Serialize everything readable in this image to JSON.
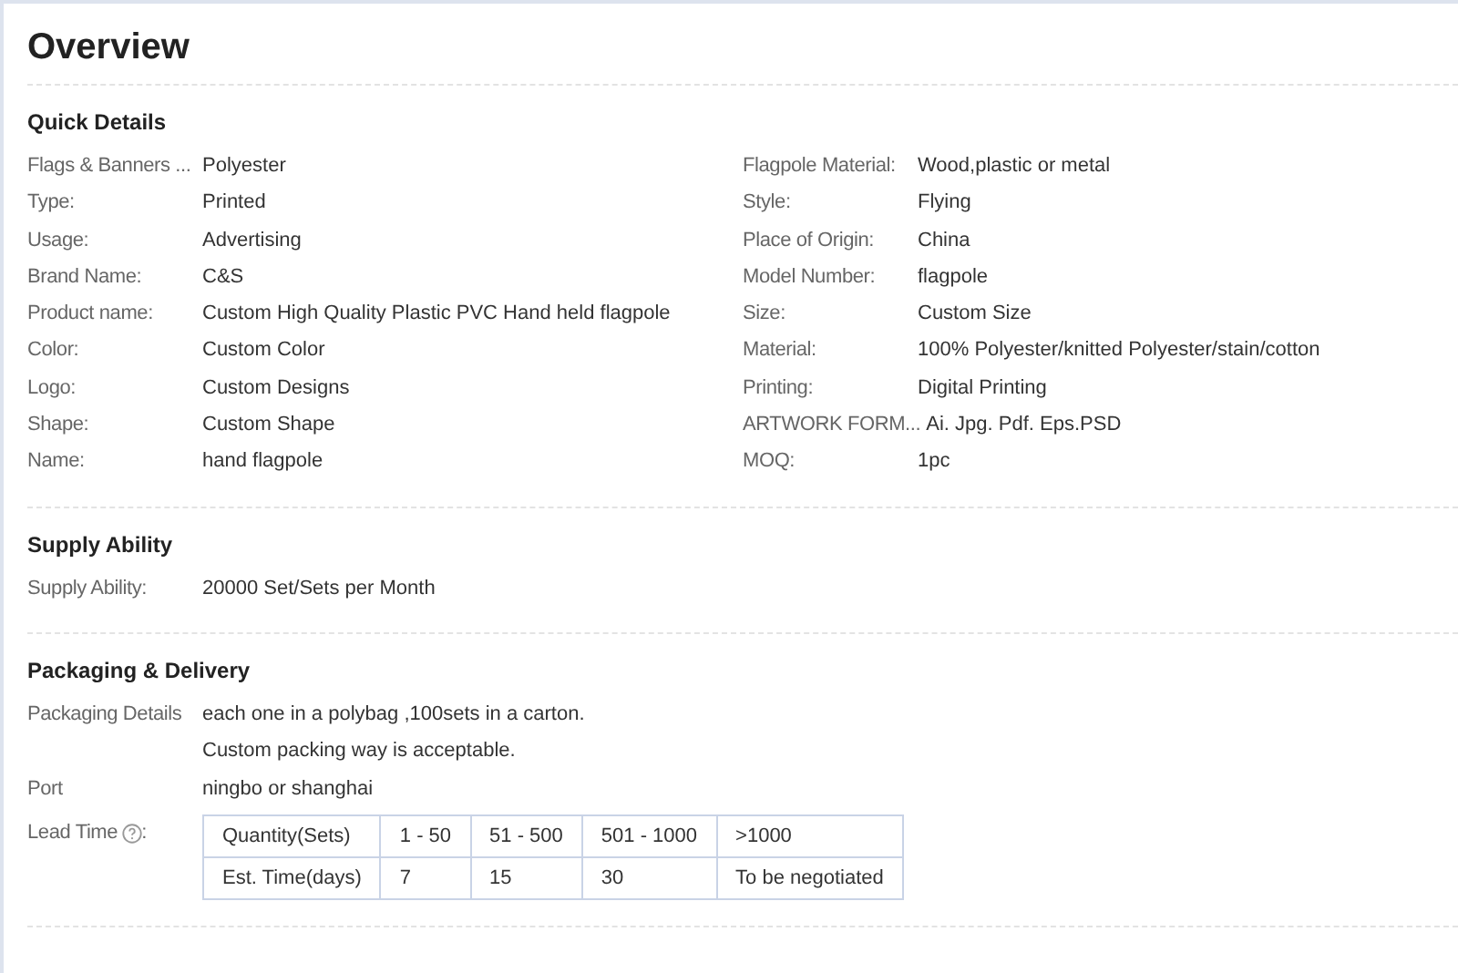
{
  "title": "Overview",
  "quick_details": {
    "title": "Quick Details",
    "columns": [
      [
        {
          "label": "Flags & Banners ...",
          "value": "Polyester"
        },
        {
          "label": "Type:",
          "value": "Printed"
        },
        {
          "label": "Usage:",
          "value": "Advertising"
        },
        {
          "label": "Brand Name:",
          "value": "C&S"
        },
        {
          "label": "Product name:",
          "value": "Custom High Quality Plastic PVC Hand held flagpole"
        },
        {
          "label": "Color:",
          "value": "Custom Color"
        },
        {
          "label": "Logo:",
          "value": "Custom Designs"
        },
        {
          "label": "Shape:",
          "value": "Custom Shape"
        },
        {
          "label": "Name:",
          "value": "hand flagpole"
        }
      ],
      [
        {
          "label": "Flagpole Material:",
          "value": "Wood,plastic or metal"
        },
        {
          "label": "Style:",
          "value": "Flying"
        },
        {
          "label": "Place of Origin:",
          "value": "China"
        },
        {
          "label": "Model Number:",
          "value": "flagpole"
        },
        {
          "label": "Size:",
          "value": "Custom Size"
        },
        {
          "label": "Material:",
          "value": "100% Polyester/knitted Polyester/stain/cotton"
        },
        {
          "label": "Printing:",
          "value": "Digital Printing"
        },
        {
          "label": "ARTWORK FORM...",
          "value": "Ai. Jpg. Pdf. Eps.PSD"
        },
        {
          "label": "MOQ:",
          "value": "1pc"
        }
      ]
    ]
  },
  "supply_ability": {
    "title": "Supply Ability",
    "rows": [
      {
        "label": "Supply Ability:",
        "value": "20000 Set/Sets per Month"
      }
    ]
  },
  "packaging_delivery": {
    "title": "Packaging & Delivery",
    "rows": [
      {
        "label": "Packaging Details",
        "lines": [
          "each one in a polybag ,100sets in a carton.",
          "Custom packing way is acceptable."
        ]
      },
      {
        "label": "Port",
        "lines": [
          "ningbo or shanghai"
        ]
      }
    ],
    "lead_time": {
      "label": "Lead Time",
      "suffix": ":",
      "table": [
        [
          "Quantity(Sets)",
          "1 - 50",
          "51 - 500",
          "501 - 1000",
          ">1000"
        ],
        [
          "Est. Time(days)",
          "7",
          "15",
          "30",
          "To be negotiated"
        ]
      ]
    }
  }
}
